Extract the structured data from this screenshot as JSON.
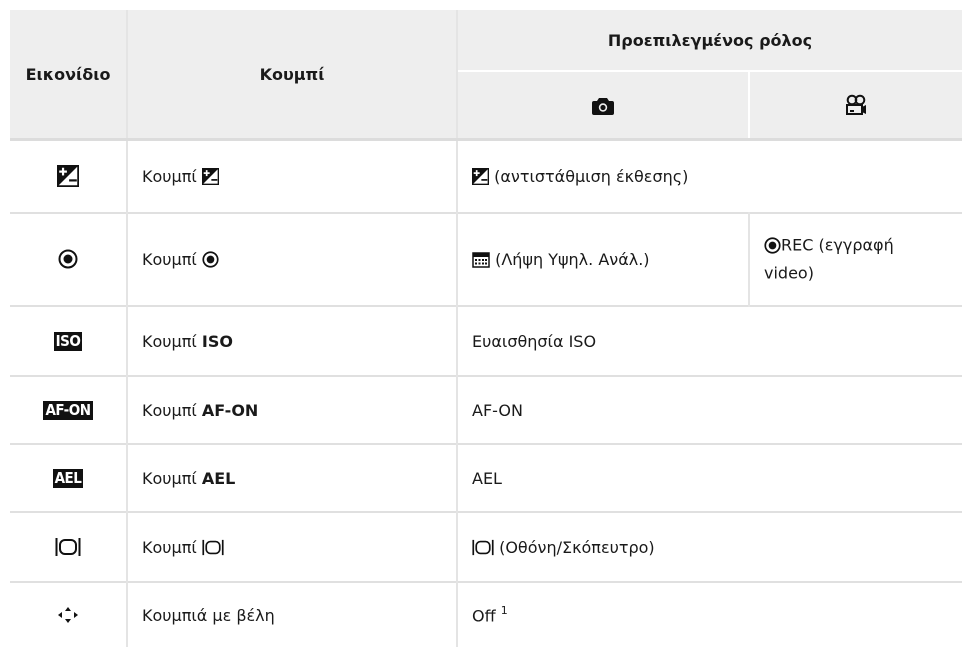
{
  "header": {
    "col_icon": "Εικονίδιο",
    "col_button": "Κουμπί",
    "col_role": "Προεπιλεγμένος ρόλος",
    "photo_icon": "camera-icon",
    "video_icon": "movie-icon"
  },
  "rows": [
    {
      "icon": "exposure-compensation-icon",
      "button_prefix": "Κουμπί",
      "button_bold": "",
      "role": "(αντιστάθμιση έκθεσης)"
    },
    {
      "icon": "record-icon",
      "button_prefix": "Κουμπί",
      "button_bold": "",
      "role_photo": "(Λήψη Υψηλ. Ανάλ.)",
      "role_video_line1": "REC (εγγραφή",
      "role_video_line2": "video)"
    },
    {
      "icon": "ISO",
      "button_prefix": "Κουμπί",
      "button_bold": "ISO",
      "role": "Ευαισθησία ISO"
    },
    {
      "icon": "AF-ON",
      "button_prefix": "Κουμπί",
      "button_bold": "AF-ON",
      "role": "AF-ON"
    },
    {
      "icon": "AEL",
      "button_prefix": "Κουμπί",
      "button_bold": "AEL",
      "role": "AEL"
    },
    {
      "icon": "monitor-viewfinder-icon",
      "button_prefix": "Κουμπί",
      "button_bold": "",
      "role": "(Οθόνη/Σκόπευτρο)"
    },
    {
      "icon": "arrow-pad-icon",
      "button_prefix": "Κουμπιά με βέλη",
      "button_bold": "",
      "role": "Off",
      "role_sup": "1"
    }
  ]
}
